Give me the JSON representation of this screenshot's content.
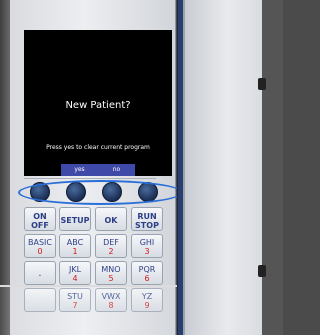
{
  "screen": {
    "message": "New Patient?",
    "subtext": "Press yes to clear current program",
    "softkeys": [
      "",
      "yes",
      "no",
      ""
    ]
  },
  "keypad": {
    "rows": [
      [
        {
          "top": "ON",
          "bottom": "OFF",
          "name": "on-off"
        },
        {
          "top": "SETUP",
          "bottom": "",
          "name": "setup"
        },
        {
          "top": "OK",
          "bottom": "",
          "name": "ok"
        },
        {
          "top": "RUN",
          "bottom": "STOP",
          "name": "run-stop"
        }
      ],
      [
        {
          "top": "BASIC",
          "num": "0",
          "name": "basic-0"
        },
        {
          "top": "ABC",
          "num": "1",
          "name": "abc-1"
        },
        {
          "top": "DEF",
          "num": "2",
          "name": "def-2"
        },
        {
          "top": "GHI",
          "num": "3",
          "name": "ghi-3"
        }
      ],
      [
        {
          "top": "",
          "num": "",
          "name": "dot"
        },
        {
          "top": "JKL",
          "num": "4",
          "name": "jkl-4"
        },
        {
          "top": "MNO",
          "num": "5",
          "name": "mno-5"
        },
        {
          "top": "PQR",
          "num": "6",
          "name": "pqr-6"
        }
      ],
      [
        {
          "top": "",
          "num": "",
          "name": "blank"
        },
        {
          "top": "STU",
          "num": "7",
          "name": "stu-7"
        },
        {
          "top": "VWX",
          "num": "8",
          "name": "vwx-8"
        },
        {
          "top": "YZ",
          "num": "9",
          "name": "yz-9"
        }
      ]
    ]
  },
  "colors": {
    "highlight_oval": "#2a6ed8",
    "key_text": "#2d3f86",
    "key_number": "#d11a1a"
  }
}
